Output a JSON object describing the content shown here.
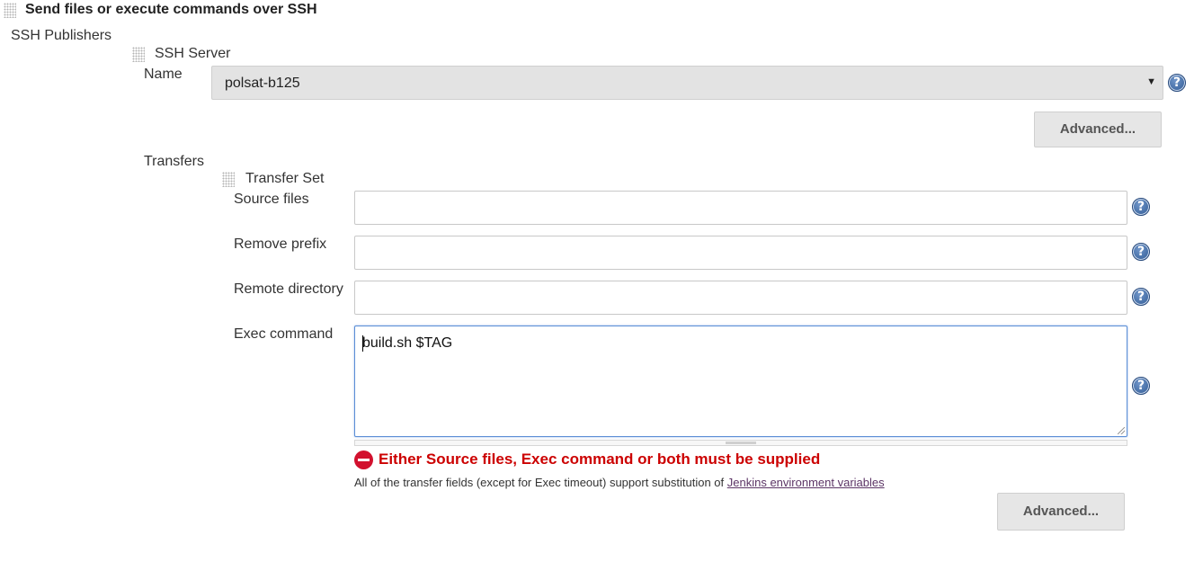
{
  "section": {
    "title": "Send files or execute commands over SSH",
    "publishers_label": "SSH Publishers"
  },
  "ssh_server": {
    "title": "SSH Server",
    "name_label": "Name",
    "name_value": "polsat-b125",
    "advanced_label": "Advanced..."
  },
  "transfers": {
    "label": "Transfers",
    "transfer_set_title": "Transfer Set",
    "source_files_label": "Source files",
    "source_files_value": "",
    "remove_prefix_label": "Remove prefix",
    "remove_prefix_value": "",
    "remote_directory_label": "Remote directory",
    "remote_directory_value": "",
    "exec_command_label": "Exec command",
    "exec_command_value": "build.sh $TAG",
    "error_message": "Either Source files, Exec command or both must be supplied",
    "note_text": "All of the transfer fields (except for Exec timeout) support substitution of ",
    "note_link": "Jenkins environment variables",
    "advanced_label": "Advanced..."
  },
  "help_glyph": "?",
  "icons": {
    "drag_handle": "drag-handle-icon",
    "help": "help-icon",
    "error": "error-icon",
    "dropdown": "dropdown-arrow-icon"
  },
  "colors": {
    "error": "#cc0000",
    "help_blue": "#3b67a3",
    "focus_border": "#5b8ed6",
    "link": "#5c3566"
  }
}
